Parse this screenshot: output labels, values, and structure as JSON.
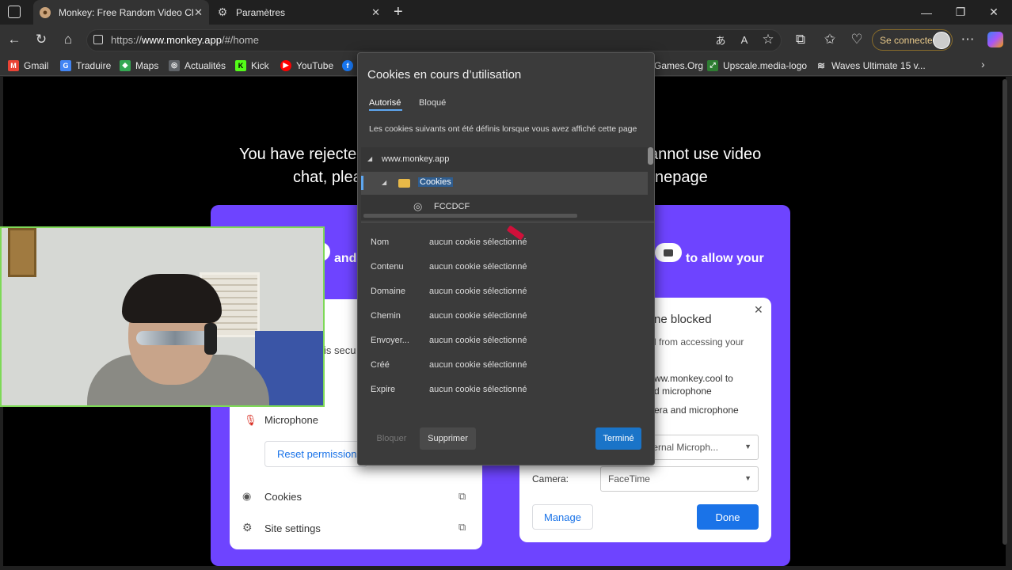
{
  "tabs": [
    {
      "title": "Monkey: Free Random Video Cha",
      "active": true
    },
    {
      "title": "Paramètres",
      "active": false
    }
  ],
  "address_bar": {
    "scheme": "https://",
    "host": "www.monkey.app",
    "path": "/#/home"
  },
  "sign_in": "Se connecter",
  "bookmarks": [
    "Gmail",
    "Traduire",
    "Maps",
    "Actualités",
    "Kick",
    "YouTube",
    "Games.Org",
    "Upscale.media-logo",
    "Waves Ultimate 15 v..."
  ],
  "page": {
    "line1_left": "You have rejecte",
    "line1_right": "annot use video",
    "line2_left": "chat, plea",
    "line2_right": "nepage",
    "purple_left": "and",
    "purple_right": "to allow your",
    "card_left": {
      "secure_fragment": "is secu",
      "microphone": "Microphone",
      "reset": "Reset permissions",
      "cookies": "Cookies",
      "site_settings": "Site settings"
    },
    "card_right": {
      "title": "ne blocked",
      "desc": "l from accessing your",
      "line1": "ww.monkey.cool to",
      "line2": "d microphone",
      "line3": "era and microphone",
      "mic_select": "ternal Microph...",
      "camera_label": "Camera:",
      "camera_select": "FaceTime",
      "manage": "Manage",
      "done": "Done"
    }
  },
  "dialog": {
    "title": "Cookies en cours d’utilisation",
    "tab_allowed": "Autorisé",
    "tab_blocked": "Bloqué",
    "subtitle": "Les cookies suivants ont été définis lorsque vous avez affiché cette page",
    "tree": {
      "site": "www.monkey.app",
      "folder": "Cookies",
      "cookie": "FCCDCF"
    },
    "fields": [
      {
        "label": "Nom",
        "value": "aucun cookie sélectionné"
      },
      {
        "label": "Contenu",
        "value": "aucun cookie sélectionné"
      },
      {
        "label": "Domaine",
        "value": "aucun cookie sélectionné"
      },
      {
        "label": "Chemin",
        "value": "aucun cookie sélectionné"
      },
      {
        "label": "Envoyer...",
        "value": "aucun cookie sélectionné"
      },
      {
        "label": "Créé",
        "value": "aucun cookie sélectionné"
      },
      {
        "label": "Expire",
        "value": "aucun cookie sélectionné"
      }
    ],
    "btn_block": "Bloquer",
    "btn_delete": "Supprimer",
    "btn_done": "Terminé"
  },
  "colors": {
    "accent_blue": "#1a74c8",
    "purple": "#6e44ff",
    "webcam_border": "#7ed957"
  }
}
